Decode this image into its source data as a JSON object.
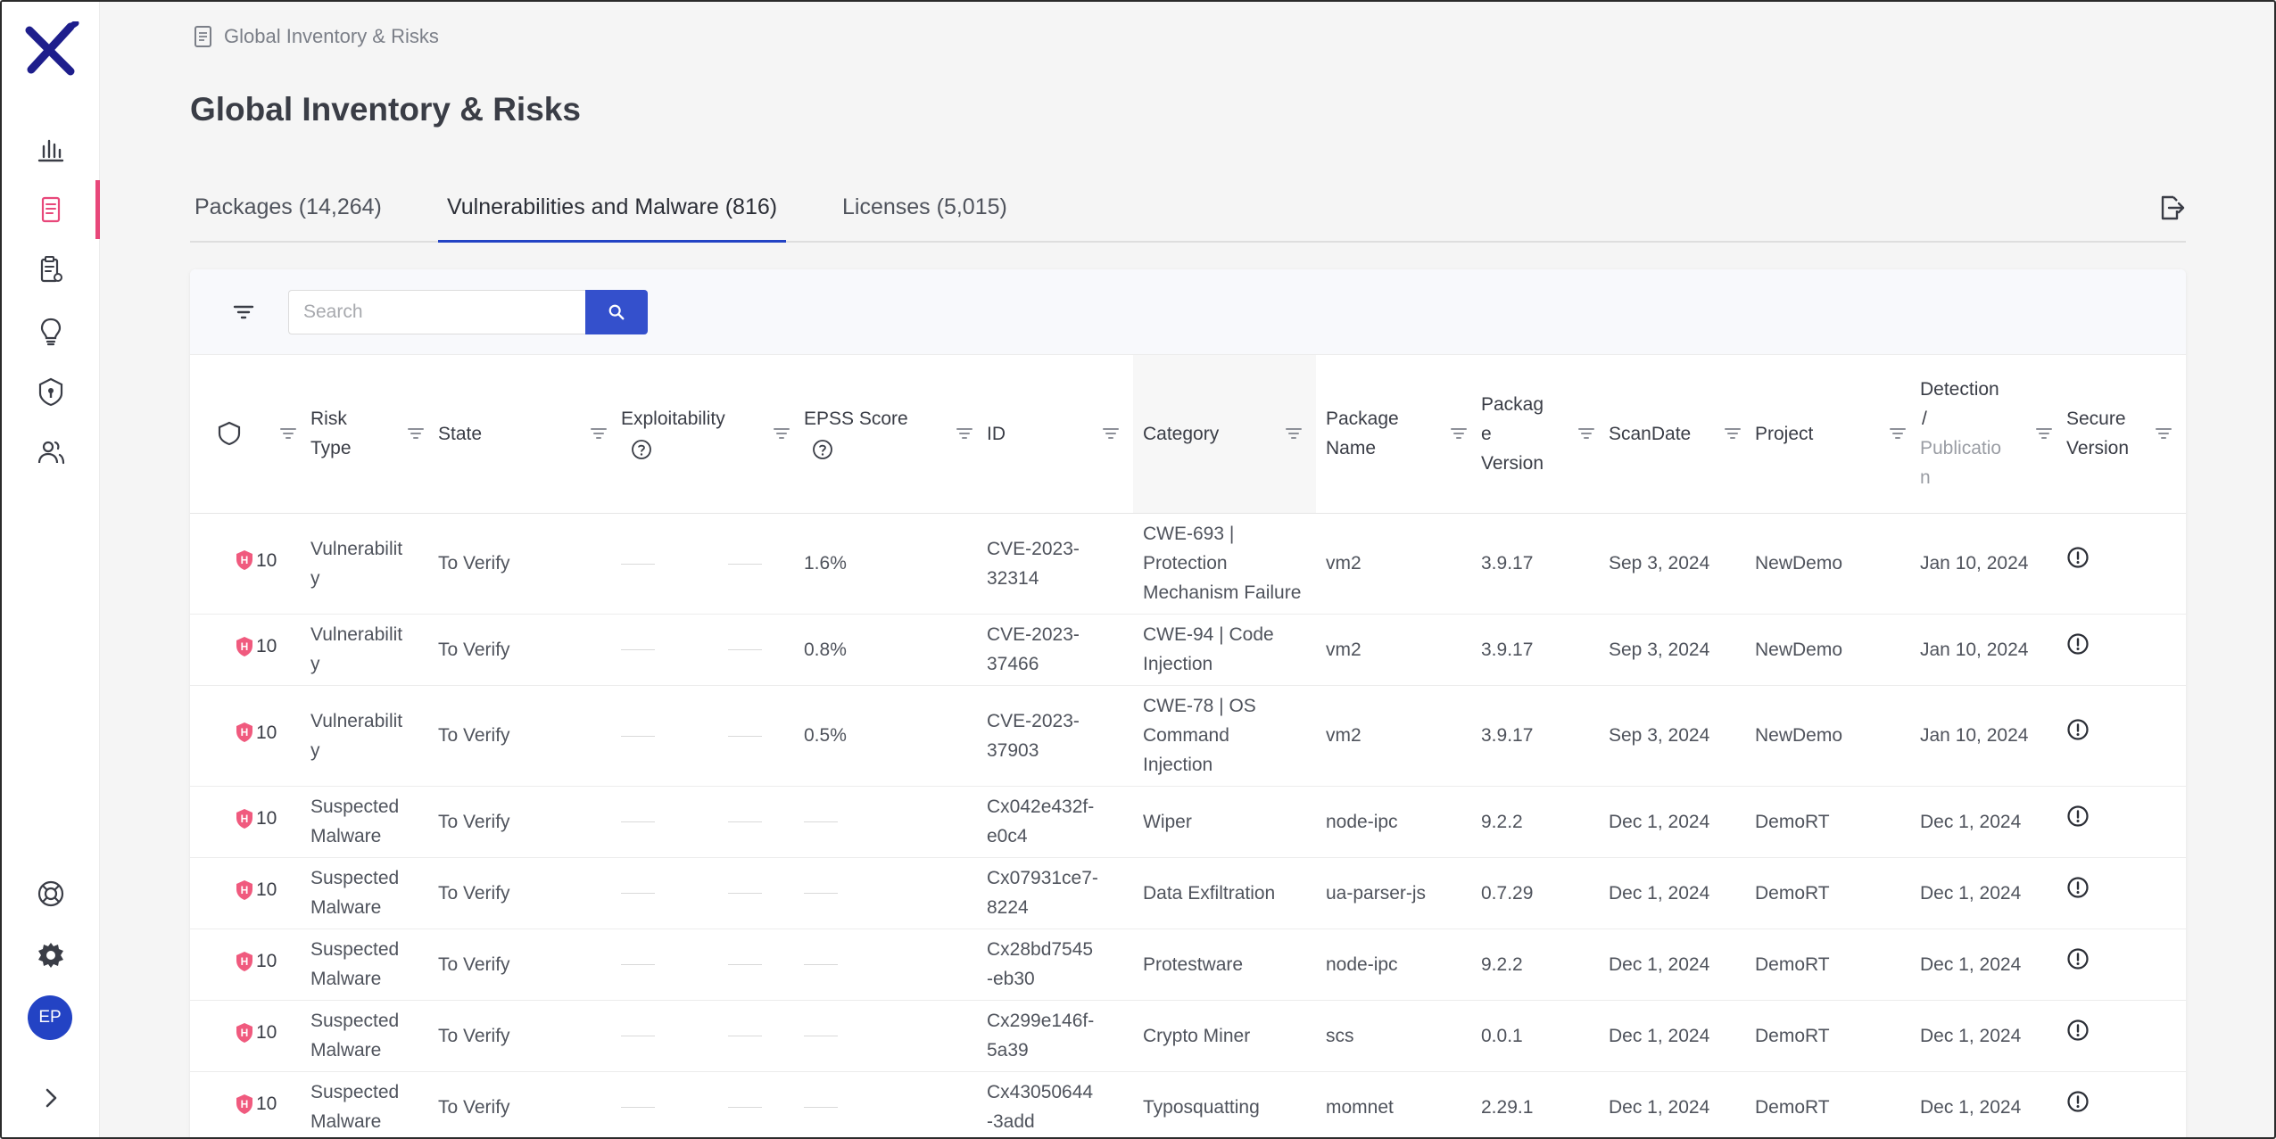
{
  "sidebar": {
    "avatar_initials": "EP",
    "accent_color": "#e8477a",
    "brand_color": "#1e1e8c"
  },
  "breadcrumb": {
    "label": "Global Inventory & Risks"
  },
  "page": {
    "title": "Global Inventory & Risks"
  },
  "tabs": [
    {
      "label": "Packages (14,264)",
      "active": false
    },
    {
      "label": "Vulnerabilities and Malware (816)",
      "active": true
    },
    {
      "label": "Licenses (5,015)",
      "active": false
    }
  ],
  "search": {
    "placeholder": "Search",
    "value": ""
  },
  "table": {
    "headers": {
      "risk_type": [
        "Risk",
        "Type"
      ],
      "state": "State",
      "exploitability": "Exploitability",
      "epss": "EPSS Score",
      "id": "ID",
      "category": "Category",
      "package_name": [
        "Package",
        "Name"
      ],
      "package_version": [
        "Packag",
        "e",
        "Version"
      ],
      "scan_date": "ScanDate",
      "project": "Project",
      "detection": [
        "Detection",
        "/",
        "Publicatio",
        "n"
      ],
      "secure_version": [
        "Secure",
        "Version"
      ]
    },
    "rows": [
      {
        "severity": "10",
        "risk_type": [
          "Vulnerabilit",
          "y"
        ],
        "state": "To Verify",
        "epss": "1.6%",
        "id": [
          "CVE-2023-",
          "32314"
        ],
        "category": [
          "CWE-693 |",
          "Protection",
          "Mechanism Failure"
        ],
        "package_name": "vm2",
        "package_version": "3.9.17",
        "scan_date": "Sep 3, 2024",
        "project": "NewDemo",
        "detection": "Jan 10, 2024"
      },
      {
        "severity": "10",
        "risk_type": [
          "Vulnerabilit",
          "y"
        ],
        "state": "To Verify",
        "epss": "0.8%",
        "id": [
          "CVE-2023-",
          "37466"
        ],
        "category": [
          "CWE-94 | Code",
          "Injection"
        ],
        "package_name": "vm2",
        "package_version": "3.9.17",
        "scan_date": "Sep 3, 2024",
        "project": "NewDemo",
        "detection": "Jan 10, 2024"
      },
      {
        "severity": "10",
        "risk_type": [
          "Vulnerabilit",
          "y"
        ],
        "state": "To Verify",
        "epss": "0.5%",
        "id": [
          "CVE-2023-",
          "37903"
        ],
        "category": [
          "CWE-78 | OS",
          "Command",
          "Injection"
        ],
        "package_name": "vm2",
        "package_version": "3.9.17",
        "scan_date": "Sep 3, 2024",
        "project": "NewDemo",
        "detection": "Jan 10, 2024"
      },
      {
        "severity": "10",
        "risk_type": [
          "Suspected",
          "Malware"
        ],
        "state": "To Verify",
        "epss": "",
        "id": [
          "Cx042e432f-",
          "e0c4"
        ],
        "category": [
          "Wiper"
        ],
        "package_name": "node-ipc",
        "package_version": "9.2.2",
        "scan_date": "Dec 1, 2024",
        "project": "DemoRT",
        "detection": "Dec 1, 2024"
      },
      {
        "severity": "10",
        "risk_type": [
          "Suspected",
          "Malware"
        ],
        "state": "To Verify",
        "epss": "",
        "id": [
          "Cx07931ce7-",
          "8224"
        ],
        "category": [
          "Data Exfiltration"
        ],
        "package_name": "ua-parser-js",
        "package_version": "0.7.29",
        "scan_date": "Dec 1, 2024",
        "project": "DemoRT",
        "detection": "Dec 1, 2024"
      },
      {
        "severity": "10",
        "risk_type": [
          "Suspected",
          "Malware"
        ],
        "state": "To Verify",
        "epss": "",
        "id": [
          "Cx28bd7545",
          "-eb30"
        ],
        "category": [
          "Protestware"
        ],
        "package_name": "node-ipc",
        "package_version": "9.2.2",
        "scan_date": "Dec 1, 2024",
        "project": "DemoRT",
        "detection": "Dec 1, 2024"
      },
      {
        "severity": "10",
        "risk_type": [
          "Suspected",
          "Malware"
        ],
        "state": "To Verify",
        "epss": "",
        "id": [
          "Cx299e146f-",
          "5a39"
        ],
        "category": [
          "Crypto Miner"
        ],
        "package_name": "scs",
        "package_version": "0.0.1",
        "scan_date": "Dec 1, 2024",
        "project": "DemoRT",
        "detection": "Dec 1, 2024"
      },
      {
        "severity": "10",
        "risk_type": [
          "Suspected",
          "Malware"
        ],
        "state": "To Verify",
        "epss": "",
        "id": [
          "Cx43050644",
          "-3add"
        ],
        "category": [
          "Typosquatting"
        ],
        "package_name": "momnet",
        "package_version": "2.29.1",
        "scan_date": "Dec 1, 2024",
        "project": "DemoRT",
        "detection": "Dec 1, 2024"
      }
    ]
  }
}
